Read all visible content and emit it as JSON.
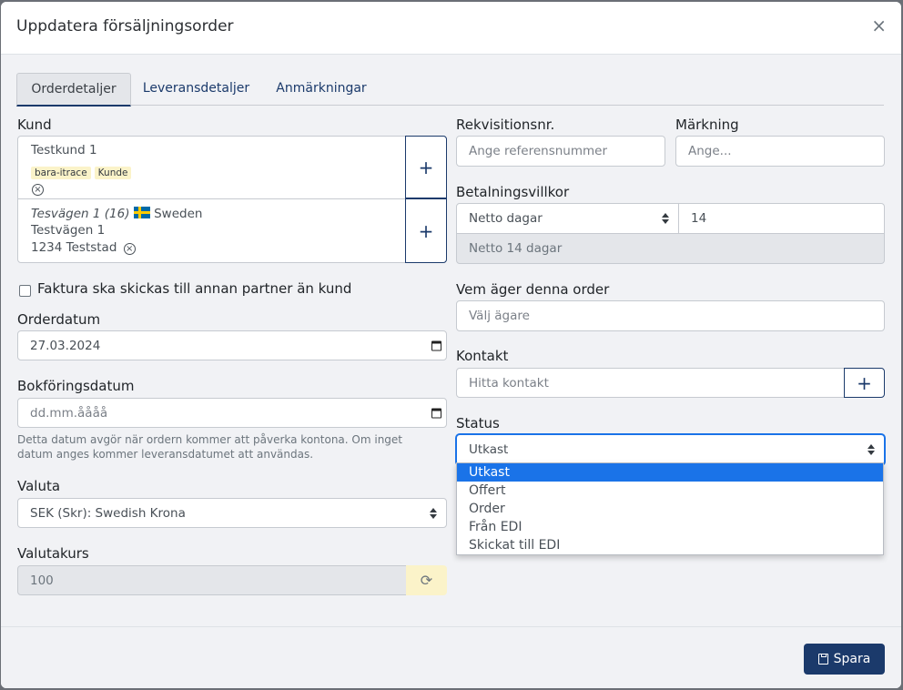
{
  "modal": {
    "title": "Uppdatera försäljningsorder",
    "close_label": "×"
  },
  "tabs": [
    {
      "label": "Orderdetaljer",
      "active": true
    },
    {
      "label": "Leveransdetaljer",
      "active": false
    },
    {
      "label": "Anmärkningar",
      "active": false
    }
  ],
  "kund": {
    "label": "Kund",
    "name": "Testkund 1",
    "tags": [
      "bara-itrace",
      "Kunde"
    ],
    "address_line1_italic": "Tesvägen 1 (16)",
    "country": "Sweden",
    "address_line2": "Testvägen 1",
    "address_line3": "1234 Teststad",
    "add_label": "+",
    "remove_symbol": "⨂"
  },
  "invoice_other_partner": {
    "label": "Faktura ska skickas till annan partner än kund",
    "checked": false
  },
  "orderdatum": {
    "label": "Orderdatum",
    "value": "27.03.2024"
  },
  "bokforingsdatum": {
    "label": "Bokföringsdatum",
    "placeholder": "dd.mm.åååå",
    "help": "Detta datum avgör när ordern kommer att påverka kontona. Om inget datum anges kommer leveransdatumet att användas."
  },
  "valuta": {
    "label": "Valuta",
    "value": "SEK (Skr): Swedish Krona"
  },
  "valutakurs": {
    "label": "Valutakurs",
    "value": "100",
    "refresh_symbol": "⟳"
  },
  "rekvisitionsnr": {
    "label": "Rekvisitionsnr.",
    "placeholder": "Ange referensnummer"
  },
  "markning": {
    "label": "Märkning",
    "placeholder": "Ange..."
  },
  "betalningsvillkor": {
    "label": "Betalningsvillkor",
    "type_value": "Netto dagar",
    "days_value": "14",
    "summary": "Netto 14 dagar"
  },
  "agare": {
    "label": "Vem äger denna order",
    "placeholder": "Välj ägare"
  },
  "kontakt": {
    "label": "Kontakt",
    "placeholder": "Hitta kontakt",
    "add_label": "+"
  },
  "status": {
    "label": "Status",
    "value": "Utkast",
    "options": [
      "Utkast",
      "Offert",
      "Order",
      "Från EDI",
      "Skickat till EDI"
    ],
    "selected_index": 0
  },
  "footer": {
    "save_label": "Spara"
  },
  "colors": {
    "primary": "#1b3a6b",
    "selected_option": "#1a73e8",
    "tag_bg": "#fbf3c9",
    "body_bg": "#f1f2f5"
  }
}
